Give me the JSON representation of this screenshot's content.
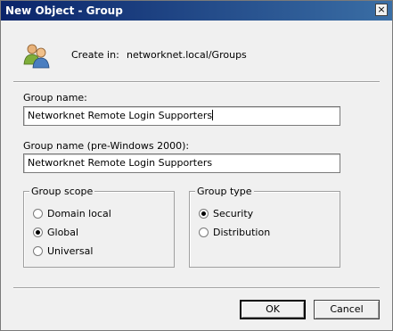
{
  "window": {
    "title": "New Object - Group",
    "close_label": "×"
  },
  "create": {
    "icon": "group-users-icon",
    "label": "Create in:",
    "value": "networknet.local/Groups"
  },
  "group_name": {
    "label": "Group name:",
    "value": "Networknet Remote Login Supporters"
  },
  "group_name_pre2000": {
    "label": "Group name (pre-Windows 2000):",
    "value": "Networknet Remote Login Supporters"
  },
  "group_scope": {
    "title": "Group scope",
    "options": [
      {
        "label": "Domain local",
        "checked": false
      },
      {
        "label": "Global",
        "checked": true
      },
      {
        "label": "Universal",
        "checked": false
      }
    ]
  },
  "group_type": {
    "title": "Group type",
    "options": [
      {
        "label": "Security",
        "checked": true
      },
      {
        "label": "Distribution",
        "checked": false
      }
    ]
  },
  "buttons": {
    "ok": "OK",
    "cancel": "Cancel"
  }
}
